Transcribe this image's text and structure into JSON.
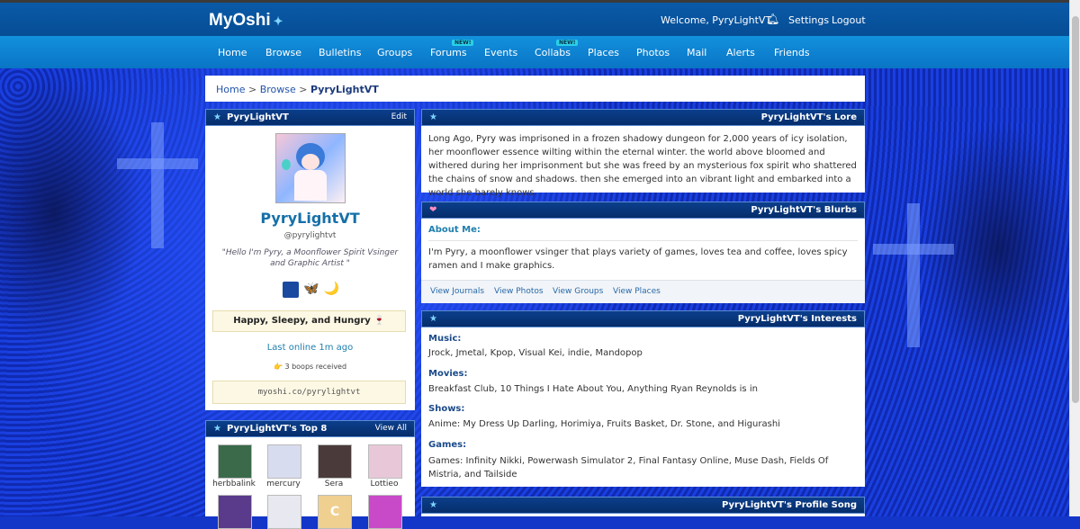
{
  "app": {
    "logo": "MyOshi",
    "logo_spark": "✦"
  },
  "topbar": {
    "welcome": "Welcome, PyryLightVT",
    "settings": "Settings",
    "logout": "Logout"
  },
  "nav": {
    "items": [
      "Home",
      "Browse",
      "Bulletins",
      "Groups",
      "Forums",
      "Events",
      "Collabs",
      "Places",
      "Photos",
      "Mail",
      "Alerts",
      "Friends"
    ],
    "new_badge": "NEW!"
  },
  "breadcrumb": {
    "home": "Home",
    "sep": ">",
    "browse": "Browse",
    "current": "PyryLightVT"
  },
  "profile": {
    "header": "PyryLightVT",
    "edit": "Edit",
    "name": "PyryLightVT",
    "handle": "@pyrylightvt",
    "quote": "\"Hello I'm Pyry, a Moonflower Spirit Vsinger and Graphic Artist \"",
    "badges": [
      "🎨",
      "🦋",
      "🌙"
    ],
    "mood": "Happy, Sleepy, and Hungry 🍷",
    "last_online": "Last online 1m ago",
    "boops_icon": "👉",
    "boops": "3 boops received",
    "url": "myoshi.co/pyrylightvt"
  },
  "top8": {
    "header": "PyryLightVT's Top 8",
    "view_all": "View All",
    "friends": [
      {
        "name": "herbbalink",
        "color": "#3a6a4a"
      },
      {
        "name": "mercury",
        "color": "#d8dcef"
      },
      {
        "name": "Sera",
        "color": "#4a3a3a"
      },
      {
        "name": "Lottieo",
        "color": "#e8c8d8"
      }
    ],
    "second_row_colors": [
      "#5a3a8a",
      "#e8e8f0",
      "#f0d090",
      "#c84ac8"
    ],
    "second_row_letter": "C"
  },
  "lore": {
    "header": "PyryLightVT's Lore",
    "text": "Long Ago, Pyry was imprisoned in a frozen shadowy dungeon for 2,000 years of icy isolation, her moonflower essence wilting within the eternal winter. the world above bloomed and withered during her imprisonment but she was freed by an mysterious fox spirit who shattered the chains of snow and shadows. then she emerged into an vibrant light and embarked into a world she barely knows."
  },
  "blurbs": {
    "header": "PyryLightVT's Blurbs",
    "about_label": "About Me:",
    "about_text": "I'm Pyry, a moonflower vsinger that plays variety of games, loves tea and coffee, loves spicy ramen and I make graphics.",
    "links": [
      "View Journals",
      "View Photos",
      "View Groups",
      "View Places"
    ]
  },
  "interests": {
    "header": "PyryLightVT's Interests",
    "music_label": "Music:",
    "music": "Jrock, Jmetal, Kpop, Visual Kei, indie, Mandopop",
    "movies_label": "Movies:",
    "movies": "Breakfast Club, 10 Things I Hate About You, Anything Ryan Reynolds is in",
    "shows_label": "Shows:",
    "shows": "Anime: My Dress Up Darling, Horimiya, Fruits Basket, Dr. Stone, and Higurashi",
    "games_label": "Games:",
    "games": "Games: Infinity Nikki, Powerwash Simulator 2, Final Fantasy Online, Muse Dash, Fields Of Mistria, and Tailside"
  },
  "song": {
    "header": "PyryLightVT's Profile Song"
  },
  "icons": {
    "star": "★",
    "heart": "❤",
    "bell": "🔔"
  },
  "colors": {
    "accent": "#1f7fae",
    "header": "#062d6a",
    "nav": "#0a74c5"
  }
}
